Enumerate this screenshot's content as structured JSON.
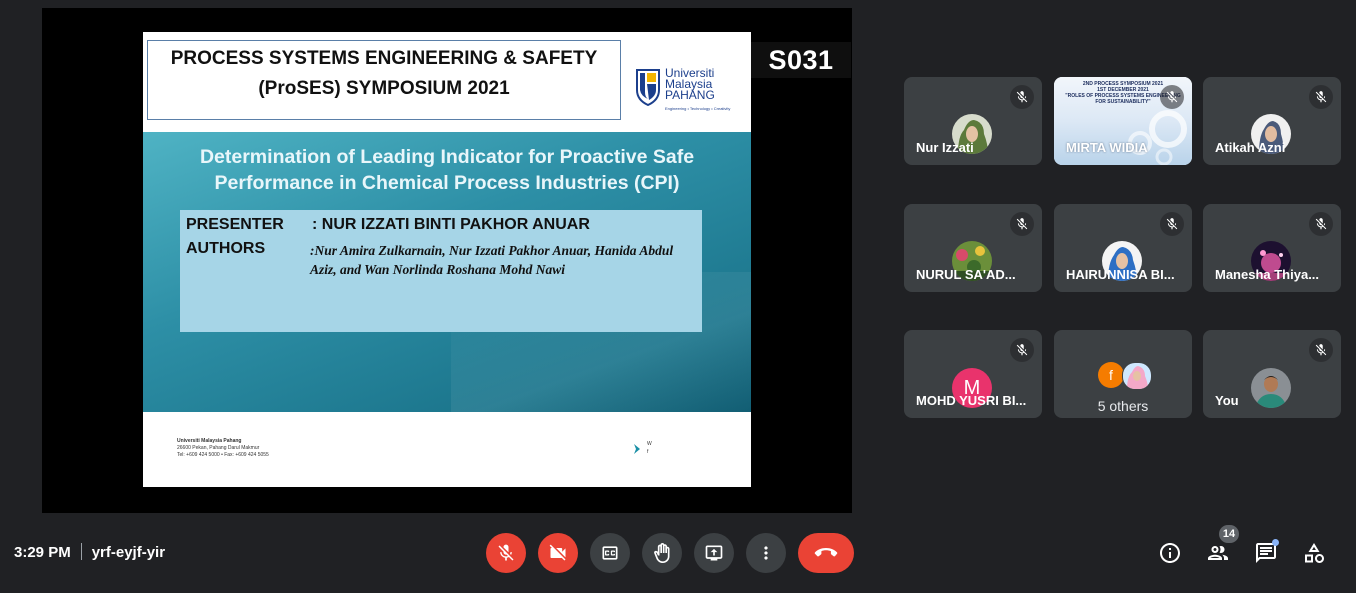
{
  "presentation": {
    "slide": {
      "header_line1": "PROCESS SYSTEMS ENGINEERING & SAFETY",
      "header_line2": "(ProSES) SYMPOSIUM 2021",
      "logo_line1": "Universiti",
      "logo_line2": "Malaysia",
      "logo_line3": "PAHANG",
      "logo_tagline": "Engineering • Technology • Creativity",
      "title_line1": "Determination of Leading Indicator for Proactive Safe",
      "title_line2": "Performance in Chemical Process Industries (CPI)",
      "presenter_label": "PRESENTER",
      "presenter_value": ": NUR IZZATI BINTI PAKHOR ANUAR",
      "authors_label": "AUTHORS",
      "authors_value": ":Nur Amira Zulkarnain, Nur Izzati Pakhor Anuar,  Hanida Abdul Aziz, and Wan Norlinda Roshana Mohd Nawi",
      "footer_org": "Universiti Malaysia Pahang",
      "footer_address": "26600 Pekan, Pahang Darul Makmur",
      "footer_contact": "Tel: +609 424 5000 •  Fax: +609 424 5055",
      "footer_web1": "W",
      "footer_web2": "f"
    },
    "session_code": "S031"
  },
  "participants": [
    {
      "name": "Nur Izzati",
      "mic": "muted",
      "avatar": "photo"
    },
    {
      "name": "MIRTA WIDIA",
      "mic": "muted",
      "avatar": "video",
      "banner_line1": "2ND PROCESS SYMPOSIUM 2021",
      "banner_line2": "1ST DECEMBER 2021",
      "banner_line3": "\"ROLES OF PROCESS SYSTEMS ENGINEERING FOR SUSTAINABILITY\""
    },
    {
      "name": "Atikah Azni",
      "mic": "muted",
      "avatar": "photo"
    },
    {
      "name": "NURUL SA'AD...",
      "mic": "muted",
      "avatar": "photo"
    },
    {
      "name": "HAIRUNNISA BI...",
      "mic": "muted",
      "avatar": "photo"
    },
    {
      "name": "Manesha Thiya...",
      "mic": "muted",
      "avatar": "photo"
    },
    {
      "name": "MOHD YUSRI BI...",
      "mic": "muted",
      "avatar": "letter",
      "letter": "M",
      "color": "#e9336c"
    },
    {
      "name": "5 others",
      "avatar": "group",
      "letter": "f",
      "color": "#f57c00"
    },
    {
      "name": "You",
      "mic": "muted",
      "avatar": "photo"
    }
  ],
  "meeting": {
    "time": "3:29 PM",
    "code": "yrf-eyjf-yir"
  },
  "controls": {
    "people_count": "14"
  },
  "colors": {
    "background": "#202124",
    "tile": "#3c4043",
    "danger": "#ea4335",
    "accent": "#8ab4f8"
  }
}
